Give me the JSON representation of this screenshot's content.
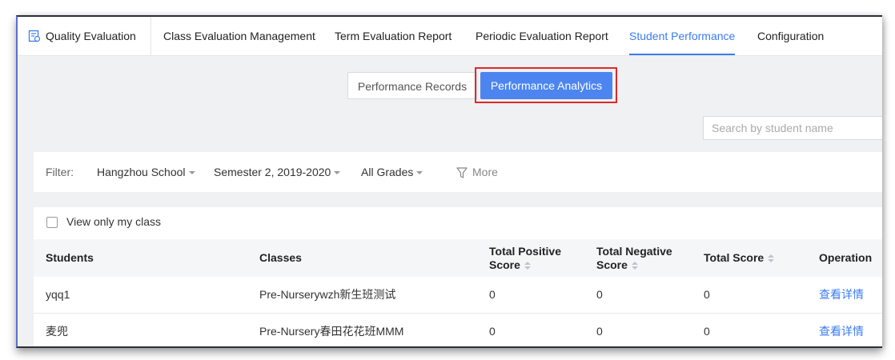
{
  "nav": {
    "brand_label": "Quality Evaluation",
    "brand_icon": "report-icon",
    "tabs": [
      {
        "label": "Class Evaluation Management"
      },
      {
        "label": "Term Evaluation Report"
      },
      {
        "label": "Periodic Evaluation Report"
      },
      {
        "label": "Student Performance",
        "active": true
      },
      {
        "label": "Configuration"
      }
    ]
  },
  "view_toggle": {
    "records_label": "Performance Records",
    "analytics_label": "Performance Analytics",
    "selected": "Performance Analytics"
  },
  "search": {
    "placeholder": "Search by student name",
    "value": ""
  },
  "filters": {
    "label": "Filter:",
    "school": "Hangzhou School",
    "semester": "Semester 2, 2019-2020",
    "grades": "All Grades",
    "more_label": "More",
    "more_icon": "filter-funnel-icon"
  },
  "table": {
    "only_my_class_label": "View only my class",
    "only_my_class_checked": false,
    "headers": {
      "students": "Students",
      "classes": "Classes",
      "positive_line1": "Total Positive",
      "positive_line2": "Score",
      "negative_line1": "Total Negative",
      "negative_line2": "Score",
      "total": "Total Score",
      "operation": "Operation"
    },
    "rows": [
      {
        "student": "yqq1",
        "class": "Pre-Nurserywzh新生班测试",
        "positive": "0",
        "negative": "0",
        "total": "0",
        "action": "查看详情"
      },
      {
        "student": "麦兜",
        "class": "Pre-Nursery春田花花班MMM",
        "positive": "0",
        "negative": "0",
        "total": "0",
        "action": "查看详情"
      }
    ]
  },
  "colors": {
    "accent": "#3b7cf0",
    "button_active": "#4d85f0",
    "highlight_box": "#e0282b",
    "page_bg": "#f0f1f3"
  }
}
